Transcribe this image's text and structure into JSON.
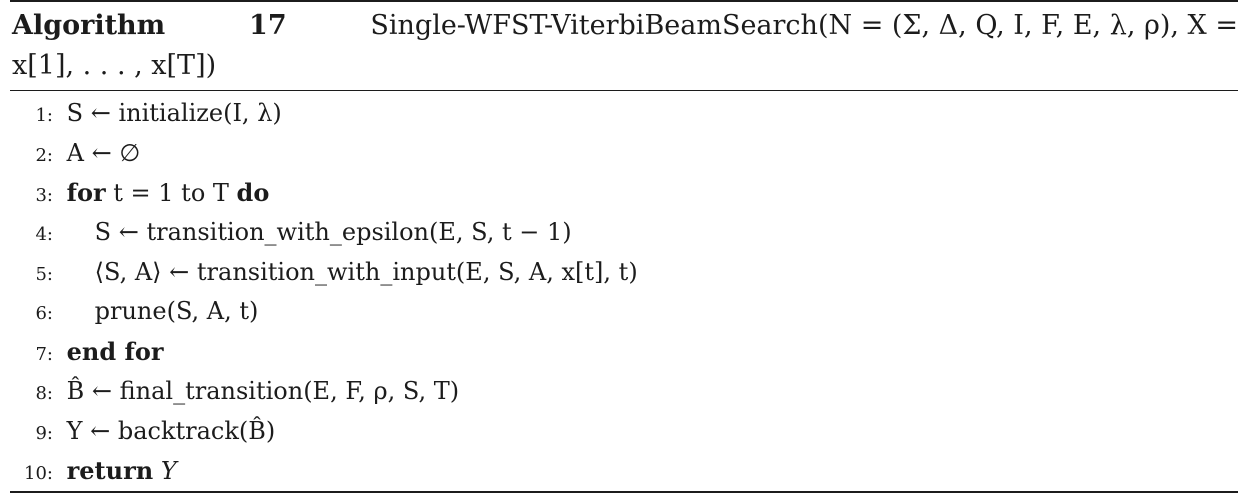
{
  "header": {
    "label": "Algorithm",
    "number": "17",
    "signature": "Single-WFST-ViterbiBeamSearch(N = (Σ, Δ, Q, I, F, E, λ, ρ), X =",
    "signature_cont": "x[1], . . . , x[T])"
  },
  "lines": [
    {
      "num": "1:",
      "text": "S ← initialize(I, λ)"
    },
    {
      "num": "2:",
      "text": "A ← ∅"
    },
    {
      "num": "3:",
      "kw": "for",
      "text": "t = 1 to T",
      "kw2": "do"
    },
    {
      "num": "4:",
      "text": "S ← transition_with_epsilon(E, S, t − 1)"
    },
    {
      "num": "5:",
      "text": "⟨S, A⟩ ← transition_with_input(E, S, A, x[t], t)"
    },
    {
      "num": "6:",
      "text": "prune(S, A, t)"
    },
    {
      "num": "7:",
      "kw": "end for"
    },
    {
      "num": "8:",
      "text": "B̂ ← final_transition(E, F, ρ, S, T)"
    },
    {
      "num": "9:",
      "text": "Y ← backtrack(B̂)"
    },
    {
      "num": "10:",
      "kw": "return",
      "text": "Y"
    }
  ]
}
